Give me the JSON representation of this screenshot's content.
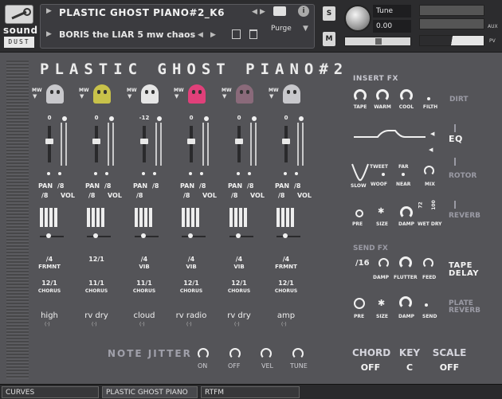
{
  "header": {
    "logo_top": "sound",
    "logo_bottom": "DUST",
    "instrument_name": "PLASTIC GHOST PIANO#2_K6",
    "snapshot_name": "BORIS the LIAR 5 mw chaos",
    "purge_label": "Purge",
    "s_button": "S",
    "m_button": "M",
    "tune_label": "Tune",
    "tune_value": "0.00",
    "aux_label": "AUX",
    "pv_label": "PV"
  },
  "panel": {
    "title": "PLASTIC GHOST PIANO#2",
    "channels": [
      {
        "mw": "MW",
        "value": "0",
        "pan": "PAN",
        "pan_div": "/8",
        "div": "/8",
        "vol": "VOL",
        "rate1": "/4",
        "mod1": "FRMNT",
        "rate2": "12/1",
        "mod2": "CHORUS",
        "fx_name": "high",
        "color": "#c8c8cc"
      },
      {
        "mw": "MW",
        "value": "0",
        "pan": "PAN",
        "pan_div": "/8",
        "div": "/8",
        "vol": "VOL",
        "rate1": "12/1",
        "mod1": "",
        "rate2": "11/1",
        "mod2": "CHORUS",
        "fx_name": "rv dry",
        "color": "#c8c24a"
      },
      {
        "mw": "MW",
        "value": "-12",
        "pan": "PAN",
        "pan_div": "/8",
        "div": "/8",
        "vol": "",
        "rate1": "/4",
        "mod1": "VIB",
        "rate2": "11/1",
        "mod2": "CHORUS",
        "fx_name": "cloud",
        "color": "#e6e6e6"
      },
      {
        "mw": "MW",
        "value": "0",
        "pan": "PAN",
        "pan_div": "/8",
        "div": "/8",
        "vol": "VOL",
        "rate1": "/4",
        "mod1": "VIB",
        "rate2": "12/1",
        "mod2": "CHORUS",
        "fx_name": "rv radio",
        "color": "#e0407a"
      },
      {
        "mw": "MW",
        "value": "0",
        "pan": "PAN",
        "pan_div": "/8",
        "div": "/8",
        "vol": "VOL",
        "rate1": "/4",
        "mod1": "VIB",
        "rate2": "12/1",
        "mod2": "CHORUS",
        "fx_name": "rv dry",
        "color": "#8a6a7a"
      },
      {
        "mw": "MW",
        "value": "0",
        "pan": "PAN",
        "pan_div": "/8",
        "div": "/8",
        "vol": "VOL",
        "rate1": "/4",
        "mod1": "FRMNT",
        "rate2": "12/1",
        "mod2": "CHORUS",
        "fx_name": "amp",
        "color": "#c8c8cc"
      }
    ],
    "insert_fx": {
      "title": "INSERT FX",
      "tape": "TAPE",
      "warm": "WARM",
      "cool": "COOL",
      "filth": "FILTH",
      "dirt": "DIRT",
      "eq": "EQ",
      "tweet": "TWEET",
      "far": "FAR",
      "slow": "SLOW",
      "woof": "WOOF",
      "near": "NEAR",
      "mix": "MIX",
      "rotor": "ROTOR",
      "pre": "PRE",
      "size": "SIZE",
      "damp": "DAMP",
      "wet_a": "72",
      "wet_b": "100",
      "wetdry": "WET DRY",
      "reverb": "REVERB"
    },
    "send_fx": {
      "title": "SEND FX",
      "rate": "/16",
      "damp": "DAMP",
      "flutter": "FLUTTER",
      "feed": "FEED",
      "tape_delay": "TAPE DELAY",
      "pre": "PRE",
      "size": "SIZE",
      "damp2": "DAMP",
      "send": "SEND",
      "plate_reverb": "PLATE REVERB"
    },
    "note_jitter": {
      "title": "NOTE JITTER",
      "on": "ON",
      "off": "OFF",
      "vel": "VEL",
      "tune": "TUNE"
    },
    "footer": {
      "chord_label": "CHORD",
      "chord_value": "OFF",
      "key_label": "KEY",
      "key_value": "C",
      "scale_label": "SCALE",
      "scale_value": "OFF"
    }
  },
  "tabs": [
    "CURVES",
    "PLASTIC GHOST PIANO",
    "RTFM"
  ]
}
